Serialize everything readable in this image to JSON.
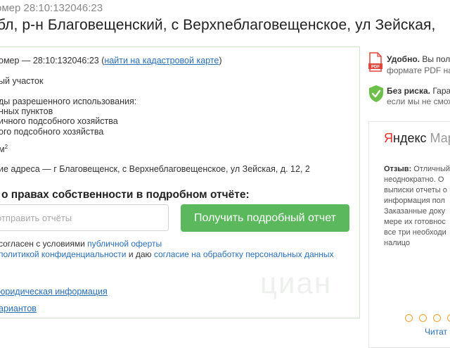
{
  "header": {
    "breadcrumb": "омер 28:10:132046:23",
    "title": "бл, р-н Благовещенский, с Верхneблаговещенское, ул Зейская,"
  },
  "card": {
    "cadastral_prefix": "омер — 28:10:132046:23 (",
    "map_link": "найти на кадастровой карте",
    "cadastral_suffix": ")",
    "line_type": "ый участок",
    "line_use_title": "ды разрешенного использования:",
    "use_1": "нных пунктов",
    "use_2": "ичного подсобного хозяйства",
    "use_3": "ого подсобного хозяйства",
    "area_unit": "м",
    "area_sup": "2",
    "address": "ие адреса — г Благовещенск, с Верхнеблаговещенское, ул Зейская, д. 12, 2",
    "report_heading": "о правах собственности в подробном отчёте:",
    "email_placeholder": "отправить отчёты",
    "get_report_button": "Получить подробный отчет",
    "agree_1_text": "согласен с условиями ",
    "agree_1_link": "публичной оферты",
    "agree_2_link_a": "политикой конфиденциальности",
    "agree_2_text": " и даю ",
    "agree_2_link_b": "согласие на обработку персональных данных",
    "legal_link": "юридическая информация",
    "variants_link": "ариантов"
  },
  "sidebar": {
    "convenient_bold": "Удобно.",
    "convenient_text": " Вы полу",
    "convenient_text_2": "формате PDF на",
    "pdf_badge": "PDF",
    "norisk_bold": "Без риска.",
    "norisk_text": " Гаран",
    "norisk_text_2": "если мы не смож",
    "yandex_brand_red": "Я",
    "yandex_brand_rest": "ндекс",
    "yandex_market": " Маркет",
    "review_label": "Отзыв:",
    "review_lines": [
      " Отличный",
      "неоднократно. О",
      "выписки отчеты о",
      "информация пол",
      "Заказанные доку",
      "мере их готовнос",
      "все три необходи",
      "налицо"
    ],
    "read_link": "Читат"
  },
  "watermark": "циан",
  "colors": {
    "accent_green": "#5cb85c",
    "link_blue": "#2a6fb8",
    "pdf_red": "#e0453a",
    "shield_green": "#6cc04a",
    "dot_orange": "#f0a030"
  }
}
